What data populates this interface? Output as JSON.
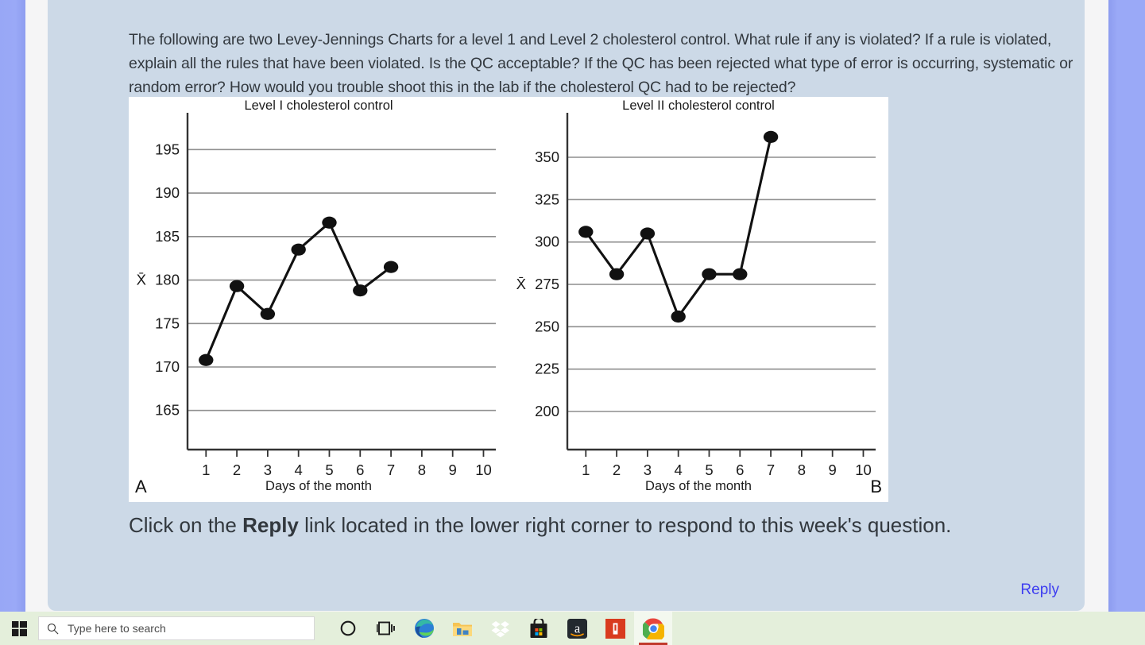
{
  "post": {
    "prompt": "The following are two Levey-Jennings Charts for a level 1 and Level 2 cholesterol control. What rule if any is violated? If a rule is violated, explain all the rules that have been violated. Is the QC acceptable? If the QC has been rejected what type of error is occurring, systematic or random error? How would you trouble shoot this in the lab if the cholesterol QC had to be rejected?",
    "closing_before": "Click on the ",
    "closing_bold": "Reply",
    "closing_after": " link located in the lower right corner to respond to this week's question.",
    "reply_label": "Reply",
    "reply_color": "#3d3df0",
    "card_color": "#ccd9e7"
  },
  "taskbar": {
    "start_label": "start-button",
    "search_placeholder": "Type here to search",
    "search_value": "",
    "icons": [
      {
        "name": "cortana-icon",
        "label": "Cortana"
      },
      {
        "name": "task-view-icon",
        "label": "Task View"
      },
      {
        "name": "microsoft-edge-icon",
        "label": "Microsoft Edge"
      },
      {
        "name": "file-explorer-icon",
        "label": "File Explorer"
      },
      {
        "name": "dropbox-icon",
        "label": "Dropbox"
      },
      {
        "name": "microsoft-store-icon",
        "label": "Microsoft Store"
      },
      {
        "name": "amazon-icon",
        "label": "Amazon"
      },
      {
        "name": "kindle-icon",
        "label": "Kindle"
      },
      {
        "name": "google-chrome-icon",
        "label": "Google Chrome"
      }
    ]
  },
  "chart_data": [
    {
      "type": "line",
      "panel": "A",
      "title": "Level I cholesterol control",
      "xlabel": "Days of the month",
      "ylabel": "",
      "mean_label": "X̄",
      "mean_value": 180,
      "x": [
        1,
        2,
        3,
        4,
        5,
        6,
        7
      ],
      "values": [
        170.8,
        179.3,
        176.1,
        183.5,
        186.6,
        178.8,
        181.5
      ],
      "xticks": [
        1,
        2,
        3,
        4,
        5,
        6,
        7,
        8,
        9,
        10
      ],
      "yticks": [
        165,
        170,
        175,
        180,
        185,
        190,
        195
      ],
      "ytick_labels": [
        "165",
        "170",
        "175",
        "180",
        "185",
        "190",
        "195"
      ],
      "xlim": [
        0.4,
        10.4
      ],
      "ylim": [
        160.5,
        198.5
      ],
      "grid": true,
      "legend": "none",
      "marker": "filled-circle",
      "color": "#111111"
    },
    {
      "type": "line",
      "panel": "B",
      "title": "Level II cholesterol control",
      "xlabel": "Days of the month",
      "ylabel": "",
      "mean_label": "X̄",
      "mean_value": 275,
      "x": [
        1,
        2,
        3,
        4,
        5,
        6,
        7
      ],
      "values": [
        306,
        281,
        305,
        256,
        281,
        281,
        362
      ],
      "xticks": [
        1,
        2,
        3,
        4,
        5,
        6,
        7,
        8,
        9,
        10
      ],
      "yticks": [
        200,
        225,
        250,
        275,
        300,
        325,
        350
      ],
      "ytick_labels": [
        "200",
        "225",
        "250",
        "275",
        "300",
        "325",
        "350"
      ],
      "xlim": [
        0.4,
        10.4
      ],
      "ylim": [
        177.5,
        372.5
      ],
      "grid": true,
      "legend": "none",
      "marker": "filled-circle",
      "color": "#111111"
    }
  ]
}
